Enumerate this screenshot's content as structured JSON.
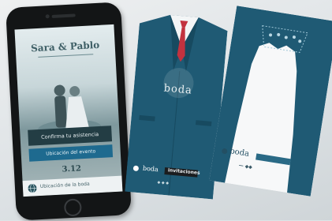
{
  "phone": {
    "app_title": "Sara & Pablo",
    "primary_button": "Confirma tu asistencia",
    "secondary_button": "Ubicación del evento",
    "date": "3.12",
    "bottom_bar_text": "Ubicación de la boda"
  },
  "groom_card": {
    "logo": "boda",
    "footer_word": "boda",
    "footer_tag": "invitaciones",
    "small_text": "◆ ◆ ◆"
  },
  "bride_card": {
    "footer_word": "boda",
    "small_text": "— ◆◆"
  },
  "colors": {
    "card_blue": "#1f5a74",
    "tie_red": "#c2323f",
    "phone_body": "#131516"
  }
}
